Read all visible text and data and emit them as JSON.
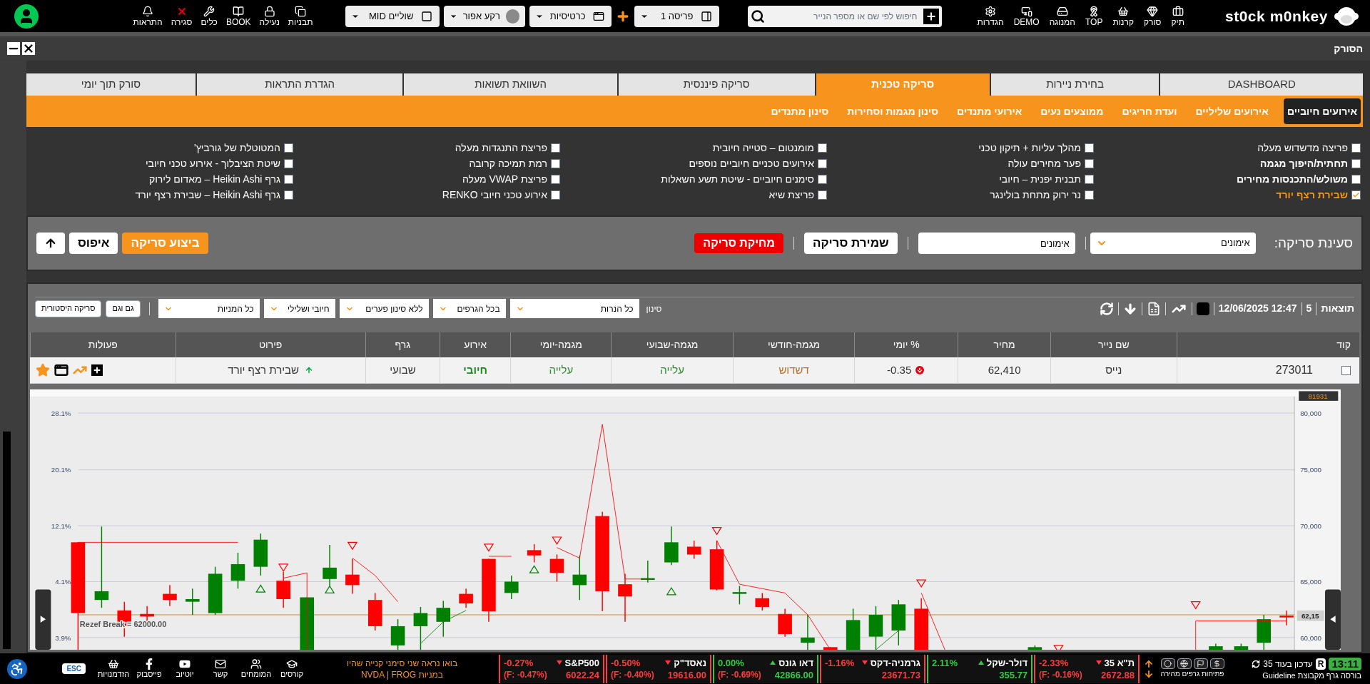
{
  "top_bar": {
    "logo": "st0ck m0nkey",
    "nav": [
      "תיק",
      "סורק",
      "קרנות",
      "TOP",
      "המנוגה",
      "DEMO",
      "הגדרות"
    ],
    "search": {
      "placeholder": "חיפוש לפי שם או מספר הנייר"
    },
    "controls": [
      {
        "label": "פריסה 1"
      },
      {
        "label": "כרטיסיות"
      },
      {
        "label": "רקע אפור"
      },
      {
        "label": "שוליים MID"
      }
    ],
    "tools": [
      "תבניות",
      "נעילה",
      "BOOK",
      "כלים",
      "סגירה",
      "התראות"
    ]
  },
  "window": {
    "title": "הסורק"
  },
  "tabs": [
    {
      "label": "DASHBOARD",
      "selected": false
    },
    {
      "label": "בחירת ניירות",
      "selected": false
    },
    {
      "label": "סריקה טכנית",
      "selected": true
    },
    {
      "label": "סריקה פיננסית",
      "selected": false
    },
    {
      "label": "השוואת תשואות",
      "selected": false
    },
    {
      "label": "הגדרת התראות",
      "selected": false
    },
    {
      "label": "סורק תוך יומי",
      "selected": false
    }
  ],
  "sub_tabs": [
    {
      "label": "אירועים חיוביים",
      "selected": true
    },
    {
      "label": "אירועים שליליים",
      "selected": false
    },
    {
      "label": "ועדת חריגים",
      "selected": false
    },
    {
      "label": "ממוצעים נעים",
      "selected": false
    },
    {
      "label": "אירועי מתנדים",
      "selected": false
    },
    {
      "label": "סינון מגמות וסחירות",
      "selected": false
    },
    {
      "label": "סינון מתנדים",
      "selected": false
    }
  ],
  "event_columns": [
    [
      {
        "label": "פריצה מדשדוש מעלה",
        "checked": false,
        "emphasized": false
      },
      {
        "label": "תחתית/היפוך מגמה",
        "checked": false,
        "emphasized": true
      },
      {
        "label": "משולש/התכנסות מחירים",
        "checked": false,
        "emphasized": true
      },
      {
        "label": "שבירת רצף יורד",
        "checked": true,
        "emphasized": true
      }
    ],
    [
      {
        "label": "מהלך עליות + תיקון טכני",
        "checked": false,
        "emphasized": false
      },
      {
        "label": "פער מחירים עולה",
        "checked": false,
        "emphasized": false
      },
      {
        "label": "תבנית יפנית – חיובי",
        "checked": false,
        "emphasized": false
      },
      {
        "label": "נר ירוק מתחת בולינגר",
        "checked": false,
        "emphasized": false
      }
    ],
    [
      {
        "label": "מומנטום – סטייה חיובית",
        "checked": false,
        "emphasized": false
      },
      {
        "label": "אירועים טכניים חיוביים נוספים",
        "checked": false,
        "emphasized": false
      },
      {
        "label": "סימנים חיוביים - שיטת תשע השאלות",
        "checked": false,
        "emphasized": false
      },
      {
        "label": "פריצת שיא",
        "checked": false,
        "emphasized": false
      }
    ],
    [
      {
        "label": "פריצת התנגדות מעלה",
        "checked": false,
        "emphasized": false
      },
      {
        "label": "רמת תמיכה קרובה",
        "checked": false,
        "emphasized": false
      },
      {
        "label": "פריצת VWAP מעלה",
        "checked": false,
        "emphasized": false
      },
      {
        "label": "אירוע טכני חיובי RENKO",
        "checked": false,
        "emphasized": false
      }
    ],
    [
      {
        "label": "המטוטלת של גורביץ'",
        "checked": false,
        "emphasized": false
      },
      {
        "label": "שיטת הציבלוך - אירוע טכני חיובי",
        "checked": false,
        "emphasized": false
      },
      {
        "label": "גרף Heikin Ashi – מאדום לירוק",
        "checked": false,
        "emphasized": false
      },
      {
        "label": "גרף Heikin Ashi – שבירת רצף יורד",
        "checked": false,
        "emphasized": false
      }
    ]
  ],
  "scan_load": {
    "label": "סעינת סריקה:",
    "selected_scan": "אימונים",
    "name_value": "אימונים",
    "save": "שמירת סריקה",
    "delete": "מחיקת סריקה",
    "run": "ביצוע סריקה",
    "reset": "איפוס"
  },
  "results": {
    "title": "תוצאות",
    "count": "5",
    "timestamp": "12/06/2025 12:47",
    "filter_label": "סינון",
    "filters": [
      "כל הנרות",
      "בכל הגרפים",
      "ללא סינון פערים",
      "חיובי ושלילי",
      "כל המניות"
    ],
    "buttons": [
      "גם וגם",
      "סריקה היסטורית"
    ],
    "table": {
      "columns": [
        "קוד",
        "שם נייר",
        "מחיר",
        "% יומי",
        "מגמה-חודשי",
        "מגמה-שבועי",
        "מגמה-יומי",
        "אירוע",
        "גרף",
        "פירוט",
        "פעולות"
      ],
      "rows": [
        {
          "checked": false,
          "code": "273011",
          "name": "נייס",
          "price": "62,410",
          "daily": "-0.35",
          "daily_falling": true,
          "monthly": {
            "text": "דשדוש",
            "color": "#c0701f"
          },
          "weekly": {
            "text": "עלייה",
            "color": "#2e8b2e"
          },
          "day": {
            "text": "עלייה",
            "color": "#2e8b2e"
          },
          "event": {
            "text": "חיובי",
            "kind": "positive"
          },
          "graph": "שבועי",
          "detail": {
            "text": "שבירת רצף יורד",
            "rising": true
          }
        }
      ]
    },
    "chart": {
      "left_ticks": [
        "28.1%",
        "20.1%",
        "12.1%",
        "4.1%",
        "3.9%"
      ],
      "right_ticks": [
        "80,000",
        "75,000",
        "70,000",
        "65,000",
        "60,000"
      ],
      "top_tag": "81931",
      "price_tag": "62,15",
      "break_label": "Rezef Break = 62000.00"
    }
  },
  "status_bar": {
    "clock": "13:11",
    "mode": "R",
    "update": "עדכון בעוד 35",
    "credit": "בורסה גרף מקבוצת Guideline",
    "quick_open": "פתיחות גרפים מהירה",
    "tickers": [
      {
        "name": "ת\"א 35",
        "rising": false,
        "color": "#ff3b3b",
        "change": "-2.33%",
        "value": "2672.88",
        "futures": "(F: -0.16%)"
      },
      {
        "name": "דולר-שקל",
        "rising": true,
        "color": "#2ecc40",
        "change": "2.11%",
        "value": "355.77"
      },
      {
        "name": "גרמניה-דקס",
        "rising": false,
        "color": "#ff3b3b",
        "change": "-1.16%",
        "value": "23671.73"
      },
      {
        "name": "דאו גונס",
        "rising": true,
        "color": "#2ecc40",
        "change": "0.00%",
        "value": "42866.00",
        "futures": "(F: -0.69%)"
      },
      {
        "name": "נאסד\"ק",
        "rising": false,
        "color": "#ff3b3b",
        "change": "-0.50%",
        "value": "19616.00",
        "futures": "(F: -0.40%)"
      },
      {
        "name": "S&P500",
        "rising": false,
        "color": "#ff3b3b",
        "change": "-0.27%",
        "value": "6022.24",
        "futures": "(F: -0.47%)"
      }
    ],
    "promo": [
      "בואו נראה שני סימני קנייה שהיו",
      "במניות NVDA | FROG"
    ],
    "links": [
      "קורסים",
      "המומחים",
      "קשר",
      "יוטיוב",
      "פייסבוק",
      "הזדמנויות"
    ],
    "esc": "ESC"
  }
}
